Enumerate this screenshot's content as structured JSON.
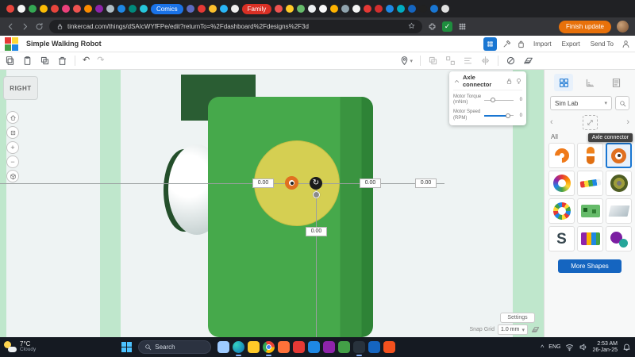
{
  "browser": {
    "tab_favicons_a": [
      "#e8453c",
      "#f5f5f5",
      "#34a853",
      "#fbbc05",
      "#e8453c",
      "#ec407a",
      "#ef5350",
      "#fb8c00",
      "#8e24aa",
      "#b0bec5",
      "#1e88e5",
      "#00897b",
      "#26c6da"
    ],
    "tab_group_comics": "Comics",
    "tab_group_comics_color": "#1a73e8",
    "tab_favicons_b": [
      "#5c6bc0",
      "#e53935",
      "#fbc02d",
      "#29b6f6",
      "#eeeeee"
    ],
    "tab_group_family": "Family",
    "tab_group_family_color": "#d93025",
    "tab_favicons_c": [
      "#ef5350",
      "#ffca28",
      "#66bb6a",
      "#eceff1",
      "#fafafa",
      "#ffb300",
      "#90a4ae",
      "#f5f5f5",
      "#e53935",
      "#d32f2f",
      "#1e88e5",
      "#00acc1",
      "#1565c0",
      "#212121",
      "#1976d2",
      "#e0e0e0"
    ],
    "url": "tinkercad.com/things/dSAIcWYfFPe/edit?returnTo=%2Fdashboard%2Fdesigns%2F3d",
    "update_button": "Finish update"
  },
  "app_header": {
    "title": "Simple Walking Robot",
    "import_button": "Import",
    "export_button": "Export",
    "send_to_button": "Send To"
  },
  "properties_panel": {
    "title": "Axle connector",
    "rows": [
      {
        "label": "Motor Torque (mNm)",
        "value": "0"
      },
      {
        "label": "Motor Speed (RPM)",
        "value": "0"
      }
    ]
  },
  "canvas": {
    "view_cube_label": "RIGHT",
    "dim_left": "0.00",
    "dim_right_inner": "0.00",
    "dim_right_outer": "0.00",
    "dim_bottom": "0.00",
    "settings_button": "Settings",
    "snap_grid_label": "Snap Grid",
    "snap_grid_value": "1.0 mm"
  },
  "sidebar": {
    "category_select": "Sim Lab",
    "all_label": "All",
    "tooltip": "Axle connector",
    "more_shapes_button": "More Shapes",
    "s_shape_glyph": "S",
    "shape_icons": [
      "claw-piece-icon",
      "axle-cap-icon",
      "axle-connector-icon",
      "rainbow-ring-icon",
      "segment-strip-icon",
      "tire-icon",
      "bead-ring-icon",
      "chip-board-icon",
      "metal-sheet-icon",
      "s-bracket-icon",
      "pcb-icon",
      "gear-set-icon"
    ]
  },
  "taskbar": {
    "weather_temp": "7°C",
    "weather_desc": "Cloudy",
    "search_label": "Search",
    "app_colors": [
      "#9ecbff",
      "edge",
      "#ffca28",
      "chrome",
      "#ff7139",
      "#e53935",
      "#1e88e5",
      "#8e24aa",
      "#43a047",
      "#28323c",
      "#1565c0",
      "#f4511e"
    ],
    "open_apps": [
      1,
      3,
      9
    ],
    "lang": "ENG",
    "time": "2:53 AM",
    "date": "26-Jan-25"
  },
  "colors": {
    "accent": "#1976d2",
    "body_green": "#46a94b",
    "dark_green": "#2a5d33",
    "wheel_yellow": "#d5cf52",
    "mint_stripe": "#bfe7cc"
  }
}
